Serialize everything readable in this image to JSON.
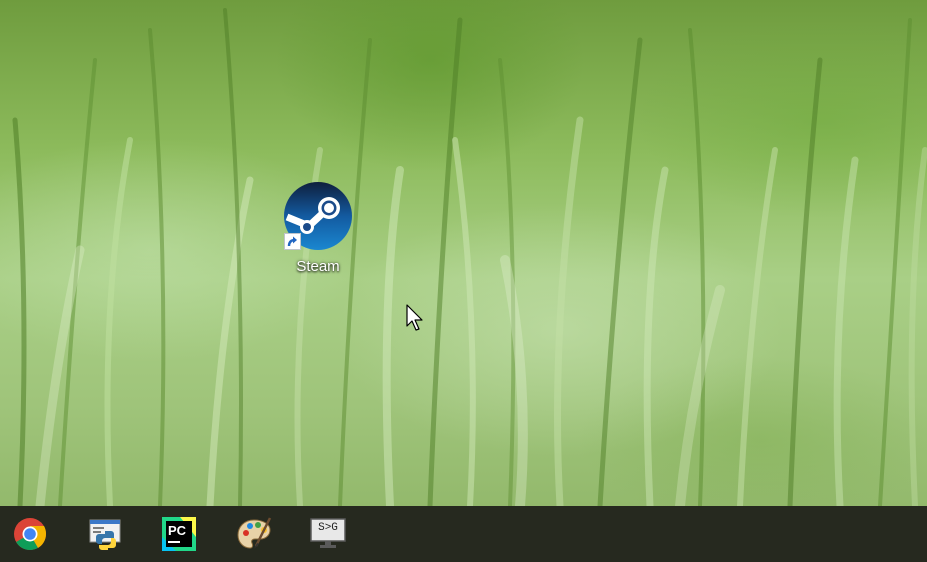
{
  "desktop": {
    "icons": [
      {
        "label": "Steam",
        "icon": "steam-icon"
      }
    ]
  },
  "taskbar": {
    "items": [
      {
        "icon": "chrome-icon"
      },
      {
        "icon": "python-icon"
      },
      {
        "icon": "pycharm-icon",
        "text": "PC"
      },
      {
        "icon": "paint-palette-icon"
      },
      {
        "icon": "terminal-monitor-icon",
        "text": "S>G"
      }
    ]
  },
  "colors": {
    "taskbar": "#26291f",
    "steam_blue": "#1a4a8a"
  }
}
